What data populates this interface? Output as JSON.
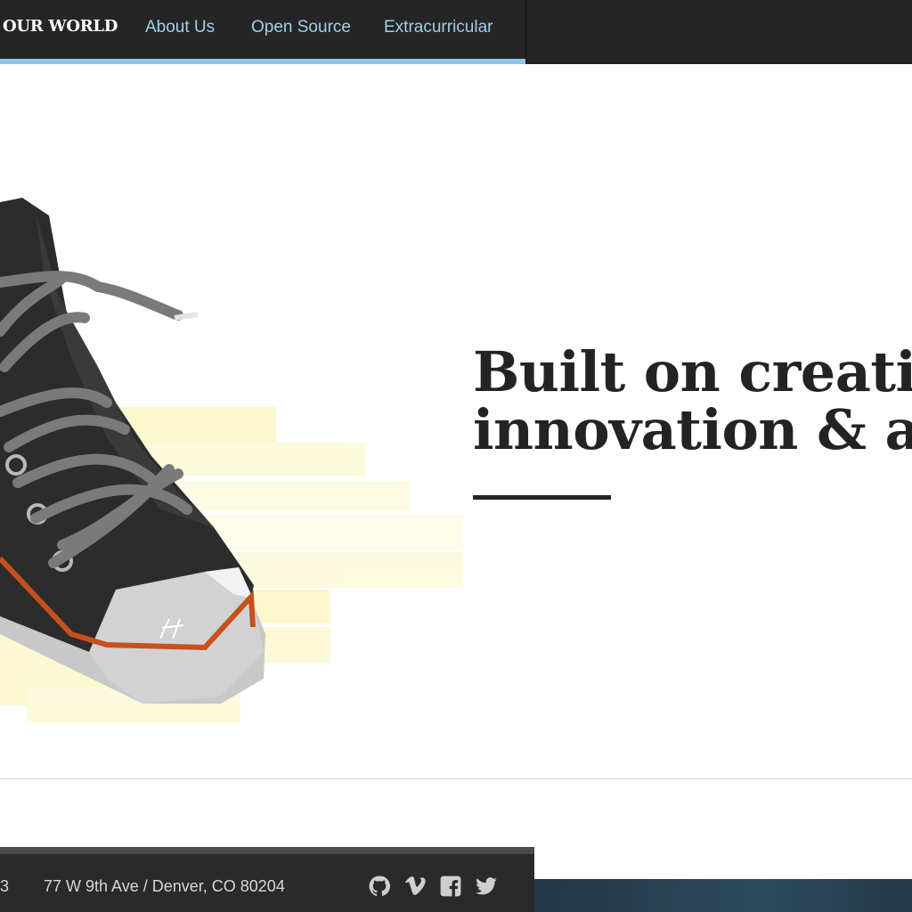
{
  "nav": {
    "brand": "OUR WORLD",
    "links": [
      {
        "label": "About Us"
      },
      {
        "label": "Open Source"
      },
      {
        "label": "Extracurricular"
      }
    ],
    "accent_color": "#8cc6e2"
  },
  "hero": {
    "heading_line1": "Built on creativ",
    "heading_line2": "innovation & a",
    "illustration": "sneaker-illustration"
  },
  "footer": {
    "fragment": "3",
    "address": "77 W 9th Ave / Denver, CO 80204",
    "social": [
      {
        "icon": "github-icon"
      },
      {
        "icon": "vimeo-icon"
      },
      {
        "icon": "facebook-icon"
      },
      {
        "icon": "twitter-icon"
      }
    ]
  }
}
